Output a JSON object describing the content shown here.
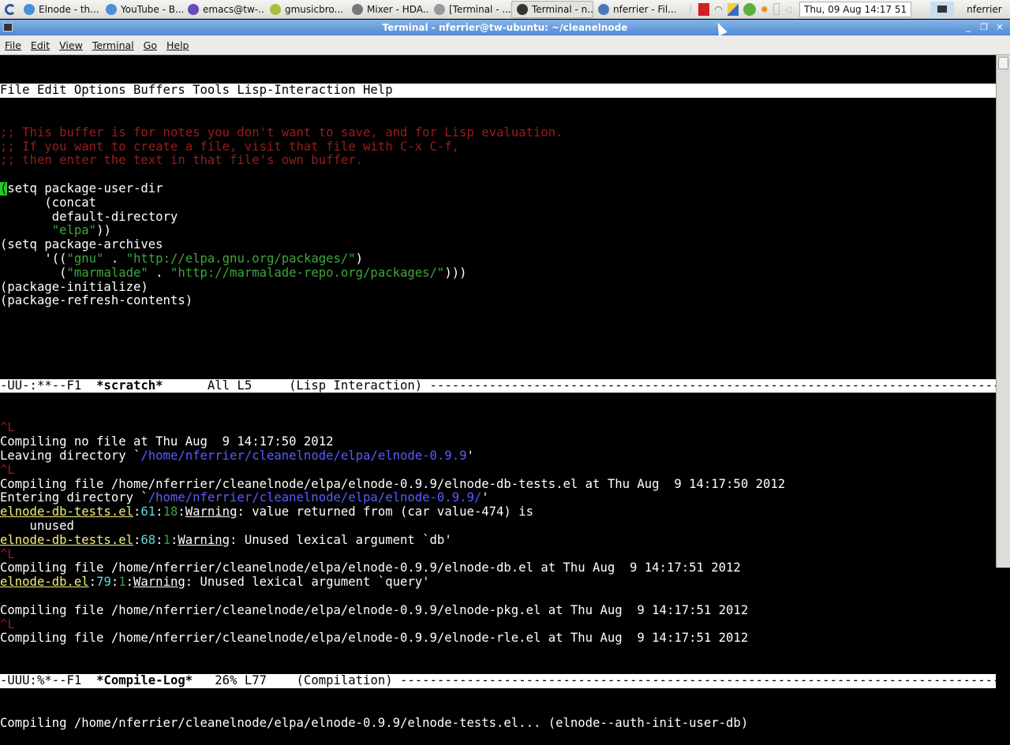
{
  "taskbar": {
    "tasks": [
      {
        "label": "Elnode - th...",
        "color": "#4a8fd8"
      },
      {
        "label": "YouTube - B...",
        "color": "#4a8fd8"
      },
      {
        "label": "emacs@tw-...",
        "color": "#6a4ab8"
      },
      {
        "label": "gmusicbro...",
        "color": "#a8c040"
      },
      {
        "label": "Mixer - HDA...",
        "color": "#777777"
      },
      {
        "label": "[Terminal - ...",
        "color": "#999999"
      },
      {
        "label": "Terminal - n...",
        "color": "#333333",
        "active": true
      },
      {
        "label": "nferrier - Fil...",
        "color": "#4a78b8"
      }
    ],
    "clock": "Thu, 09 Aug  14:17 51",
    "user": "nferrier"
  },
  "window": {
    "title": "Terminal - nferrier@tw-ubuntu: ~/cleanelnode",
    "minimize": "_",
    "maximize": "❐",
    "close": "✕"
  },
  "menubar": [
    "File",
    "Edit",
    "View",
    "Terminal",
    "Go",
    "Help"
  ],
  "emacs": {
    "menubar": "File Edit Options Buffers Tools Lisp-Interaction Help",
    "scratch_lines": [
      [
        [
          ";; This buffer is for notes you don't want to save, and for Lisp evaluation.",
          "c"
        ]
      ],
      [
        [
          ";; If you want to create a file, visit that file with C-x C-f,",
          "c"
        ]
      ],
      [
        [
          ";; then enter the text in that file's own buffer.",
          "c"
        ]
      ],
      [],
      [
        [
          "(",
          "cursor"
        ],
        [
          "setq package-user-dir",
          ""
        ]
      ],
      [
        [
          "      (concat",
          ""
        ]
      ],
      [
        [
          "       default-directory",
          ""
        ]
      ],
      [
        [
          "       ",
          ""
        ],
        [
          "\"elpa\"",
          "s"
        ],
        [
          "))",
          ""
        ]
      ],
      [
        [
          "(setq package-archives",
          ""
        ]
      ],
      [
        [
          "      '((",
          ""
        ],
        [
          "\"gnu\"",
          "s"
        ],
        [
          " . ",
          ""
        ],
        [
          "\"http://elpa.gnu.org/packages/\"",
          "s"
        ],
        [
          ")",
          ""
        ]
      ],
      [
        [
          "        (",
          ""
        ],
        [
          "\"marmalade\"",
          "s"
        ],
        [
          " . ",
          ""
        ],
        [
          "\"http://marmalade-repo.org/packages/\"",
          "s"
        ],
        [
          ")))",
          ""
        ]
      ],
      [
        [
          "(package-initialize)",
          ""
        ]
      ],
      [
        [
          "(package-refresh-contents)",
          ""
        ]
      ],
      [],
      [],
      []
    ],
    "modeline1": [
      [
        "-UU-:**--F1  ",
        ""
      ],
      [
        "*scratch*",
        "b"
      ],
      [
        "      All L5     (Lisp Interaction) -----------------------------------------------------------------------------------",
        ""
      ]
    ],
    "compile_lines": [
      [
        [
          "^L",
          "r"
        ]
      ],
      [
        [
          "Compiling no file at Thu Aug  9 14:17:50 2012",
          ""
        ]
      ],
      [
        [
          "Leaving directory `",
          ""
        ],
        [
          "/home/nferrier/cleanelnode/elpa/elnode-0.9.9",
          "d"
        ],
        [
          "'",
          ""
        ]
      ],
      [
        [
          "^L",
          "r"
        ]
      ],
      [
        [
          "Compiling file /home/nferrier/cleanelnode/elpa/elnode-0.9.9/elnode-db-tests.el at Thu Aug  9 14:17:50 2012",
          ""
        ]
      ],
      [
        [
          "Entering directory `",
          ""
        ],
        [
          "/home/nferrier/cleanelnode/elpa/elnode-0.9.9/",
          "d"
        ],
        [
          "'",
          ""
        ]
      ],
      [
        [
          "elnode-db-tests.el",
          "f"
        ],
        [
          ":",
          ""
        ],
        [
          "61",
          "n"
        ],
        [
          ":",
          ""
        ],
        [
          "18",
          "col"
        ],
        [
          ":",
          ""
        ],
        [
          "Warning",
          "w"
        ],
        [
          ": value returned from (car value-474) is",
          ""
        ]
      ],
      [
        [
          "    unused",
          ""
        ]
      ],
      [
        [
          "elnode-db-tests.el",
          "f"
        ],
        [
          ":",
          ""
        ],
        [
          "68",
          "n"
        ],
        [
          ":",
          ""
        ],
        [
          "1",
          "col"
        ],
        [
          ":",
          ""
        ],
        [
          "Warning",
          "w"
        ],
        [
          ": Unused lexical argument `db'",
          ""
        ]
      ],
      [
        [
          "^L",
          "r"
        ]
      ],
      [
        [
          "Compiling file /home/nferrier/cleanelnode/elpa/elnode-0.9.9/elnode-db.el at Thu Aug  9 14:17:51 2012",
          ""
        ]
      ],
      [
        [
          "elnode-db.el",
          "f"
        ],
        [
          ":",
          ""
        ],
        [
          "79",
          "n"
        ],
        [
          ":",
          ""
        ],
        [
          "1",
          "col"
        ],
        [
          ":",
          ""
        ],
        [
          "Warning",
          "w"
        ],
        [
          ": Unused lexical argument `query'",
          ""
        ]
      ],
      [],
      [
        [
          "Compiling file /home/nferrier/cleanelnode/elpa/elnode-0.9.9/elnode-pkg.el at Thu Aug  9 14:17:51 2012",
          ""
        ]
      ],
      [
        [
          "^L",
          "r"
        ]
      ],
      [
        [
          "Compiling file /home/nferrier/cleanelnode/elpa/elnode-0.9.9/elnode-rle.el at Thu Aug  9 14:17:51 2012",
          ""
        ]
      ]
    ],
    "modeline2": [
      [
        "-UUU:%*--F1  ",
        ""
      ],
      [
        "*Compile-Log*",
        "b"
      ],
      [
        "   26% L77    (Compilation) ---------------------------------------------------------------------------------------",
        ""
      ]
    ],
    "minibuffer": "Compiling /home/nferrier/cleanelnode/elpa/elnode-0.9.9/elnode-tests.el... (elnode--auth-init-user-db)"
  }
}
